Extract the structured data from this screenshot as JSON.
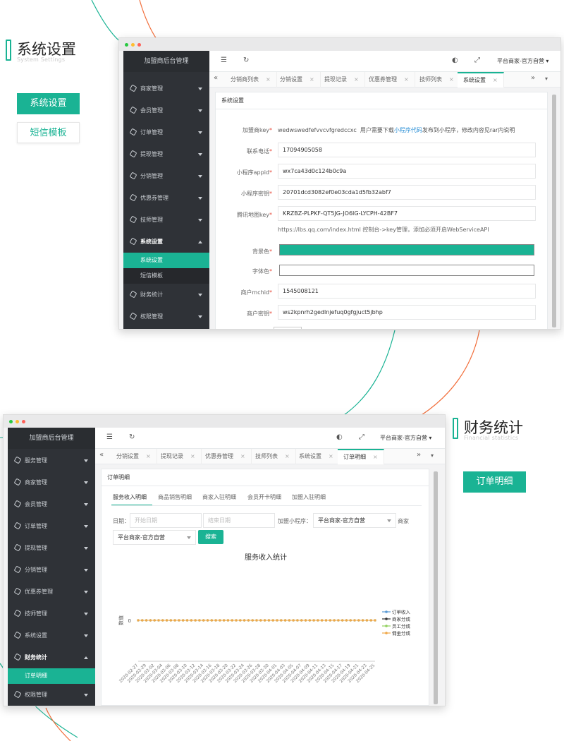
{
  "colors": {
    "accent": "#1ab394",
    "orange_line": "#f26f3c",
    "sidebar_bg": "#2f3237",
    "dot_red": "#ff6159",
    "dot_yellow": "#ffbd2e",
    "dot_green": "#28c941"
  },
  "section1": {
    "title": "系统设置",
    "subtitle": "System Settings",
    "buttons": {
      "active": "系统设置",
      "inactive": "短信模板"
    },
    "app": {
      "brand": "加盟商后台管理",
      "user": "平台商家-官方自营",
      "menu": [
        "商家管理",
        "会员管理",
        "订单管理",
        "提现管理",
        "分销管理",
        "优惠券管理",
        "技师管理",
        "系统设置",
        "财务统计",
        "权限管理"
      ],
      "submenu": [
        "系统设置",
        "短信模板"
      ],
      "tabs": [
        "分销商列表",
        "分销设置",
        "提现记录",
        "优惠券管理",
        "技师列表",
        "系统设置"
      ],
      "panel_title": "系统设置",
      "form": {
        "merchant_key_label": "加盟商key",
        "merchant_key_value": "wedwswedfefvvcvfgredccxc",
        "merchant_key_hint_pre": "用户需要下载",
        "merchant_key_hint_link": "小程序代码",
        "merchant_key_hint_post": "发布到小程序，修改内容见rar内说明",
        "phone_label": "联系电话",
        "phone_value": "17094905058",
        "appid_label": "小程序appid",
        "appid_value": "wx7ca43d0c124b0c9a",
        "secret_label": "小程序密钥",
        "secret_value": "20701dcd3082ef0e03cda1d5fb32abf7",
        "mapkey_label": "腾讯地图key",
        "mapkey_value": "KRZBZ-PLPKF-QT5JG-JO6IG-LYCPH-42BF7",
        "mapkey_hint": "https://lbs.qq.com/index.html 控制台->key管理，添加必须开启WebServiceAPI",
        "bg_label": "背景色",
        "bg_color": "#1ab394",
        "font_label": "字体色",
        "font_color": "#ffffff",
        "mchid_label": "商户mchid",
        "mchid_value": "1545008121",
        "mkey_label": "商户密钥",
        "mkey_value": "ws2kpnrh2gedlnjefuq0gfgjuct5jbhp"
      }
    }
  },
  "section2": {
    "title": "财务统计",
    "subtitle": "Financial statistics",
    "button": "订单明细",
    "app": {
      "brand": "加盟商后台管理",
      "user": "平台商家-官方自营",
      "menu": [
        "服务管理",
        "商家管理",
        "会员管理",
        "订单管理",
        "提现管理",
        "分销管理",
        "优惠券管理",
        "技师管理",
        "系统设置",
        "财务统计",
        "权限管理"
      ],
      "submenu": [
        "订单明细"
      ],
      "tabs": [
        "分销设置",
        "提现记录",
        "优惠券管理",
        "技师列表",
        "系统设置",
        "订单明细"
      ],
      "panel_title": "订单明细",
      "subtabs": [
        "服务收入明细",
        "商品销售明细",
        "商家入驻明细",
        "会员开卡明细",
        "加盟入驻明细"
      ],
      "filter": {
        "date_label": "日期：",
        "start_placeholder": "开始日期",
        "end_placeholder": "结束日期",
        "mp_label": "加盟小程序：",
        "mp_value": "平台商家-官方自营",
        "merchant_label": "商家",
        "merchant_value": "平台商家-官方自营",
        "search": "搜索"
      }
    }
  },
  "chart_data": {
    "type": "line",
    "title": "服务收入统计",
    "ylabel": "数值",
    "y_ticks": [
      "0"
    ],
    "x": [
      "2020-02-27",
      "2020-02-29",
      "2020-03-02",
      "2020-03-04",
      "2020-03-06",
      "2020-03-08",
      "2020-03-10",
      "2020-03-12",
      "2020-03-14",
      "2020-03-16",
      "2020-03-18",
      "2020-03-20",
      "2020-03-22",
      "2020-03-24",
      "2020-03-26",
      "2020-03-28",
      "2020-03-30",
      "2020-04-01",
      "2020-04-03",
      "2020-04-05",
      "2020-04-07",
      "2020-04-09",
      "2020-04-11",
      "2020-04-13",
      "2020-04-15",
      "2020-04-17",
      "2020-04-19",
      "2020-04-21",
      "2020-04-23",
      "2020-04-25"
    ],
    "point_count": 59,
    "series": [
      {
        "name": "订单收入",
        "color": "#5b9bd5",
        "value": 0
      },
      {
        "name": "商家分成",
        "color": "#333333",
        "value": 0
      },
      {
        "name": "员工分成",
        "color": "#91d05e",
        "value": 0
      },
      {
        "name": "佣金分成",
        "color": "#f0a848",
        "value": 0
      }
    ],
    "legend": "right"
  }
}
